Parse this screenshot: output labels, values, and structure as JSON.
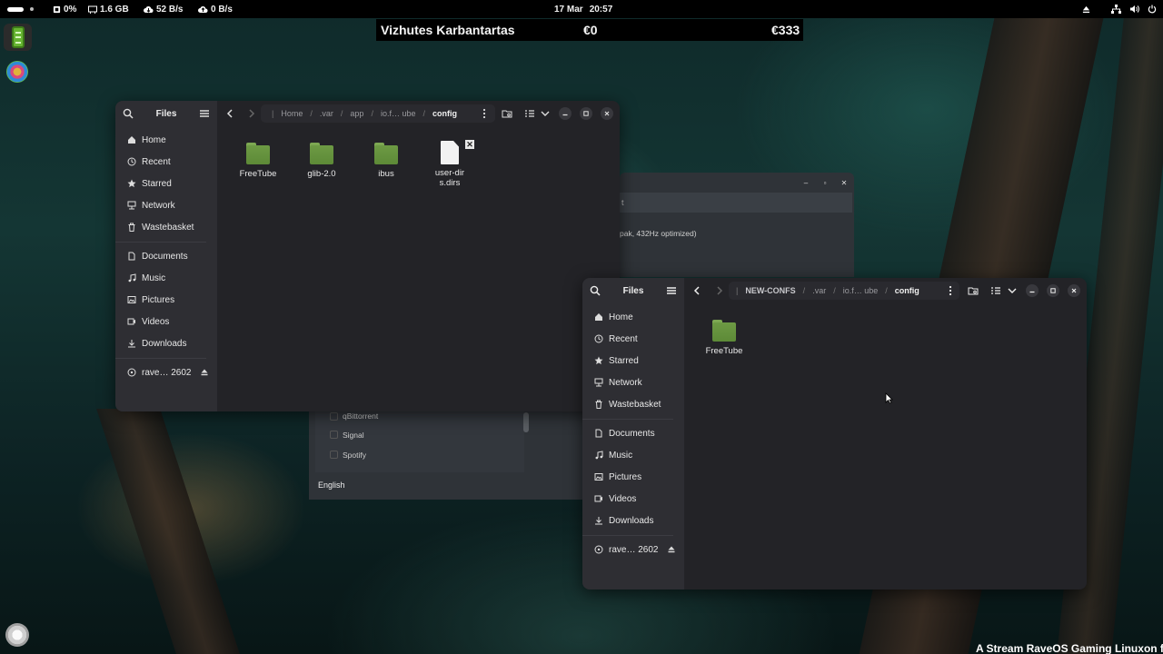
{
  "topbar": {
    "cpu": "0%",
    "memory": "1.6 GB",
    "download": "52 B/s",
    "upload": "0 B/s",
    "date": "17 Mar",
    "time": "20:57"
  },
  "ticker": {
    "name": "Vizhutes Karbantartas",
    "value1": "€0",
    "value2": "€333"
  },
  "bottom_text": "A Stream RaveOS Gaming Linuxon fut",
  "background_window": {
    "field_suffix": "t",
    "description": "pak, 432Hz optimized)",
    "list_items": [
      "qBittorrent",
      "Signal",
      "Spotify"
    ],
    "language": "English"
  },
  "files_window_1": {
    "title": "Files",
    "breadcrumbs": [
      "Home",
      ".var",
      "app",
      "io.f… ube",
      "config"
    ],
    "sidebar": [
      "Home",
      "Recent",
      "Starred",
      "Network",
      "Wastebasket",
      "Documents",
      "Music",
      "Pictures",
      "Videos",
      "Downloads"
    ],
    "drive": "rave… 2602",
    "items": [
      {
        "name": "FreeTube",
        "kind": "folder"
      },
      {
        "name": "glib-2.0",
        "kind": "folder"
      },
      {
        "name": "ibus",
        "kind": "folder"
      },
      {
        "name": "user-dirs.dirs",
        "kind": "file"
      }
    ]
  },
  "files_window_2": {
    "title": "Files",
    "breadcrumbs": [
      "NEW-CONFS",
      ".var",
      "io.f… ube",
      "config"
    ],
    "sidebar": [
      "Home",
      "Recent",
      "Starred",
      "Network",
      "Wastebasket",
      "Documents",
      "Music",
      "Pictures",
      "Videos",
      "Downloads"
    ],
    "drive": "rave… 2602",
    "items": [
      {
        "name": "FreeTube",
        "kind": "folder"
      }
    ]
  },
  "colors": {
    "window_bg": "#232327",
    "sidebar_bg": "#2e2e33",
    "folder_green": "#6d9a44"
  }
}
